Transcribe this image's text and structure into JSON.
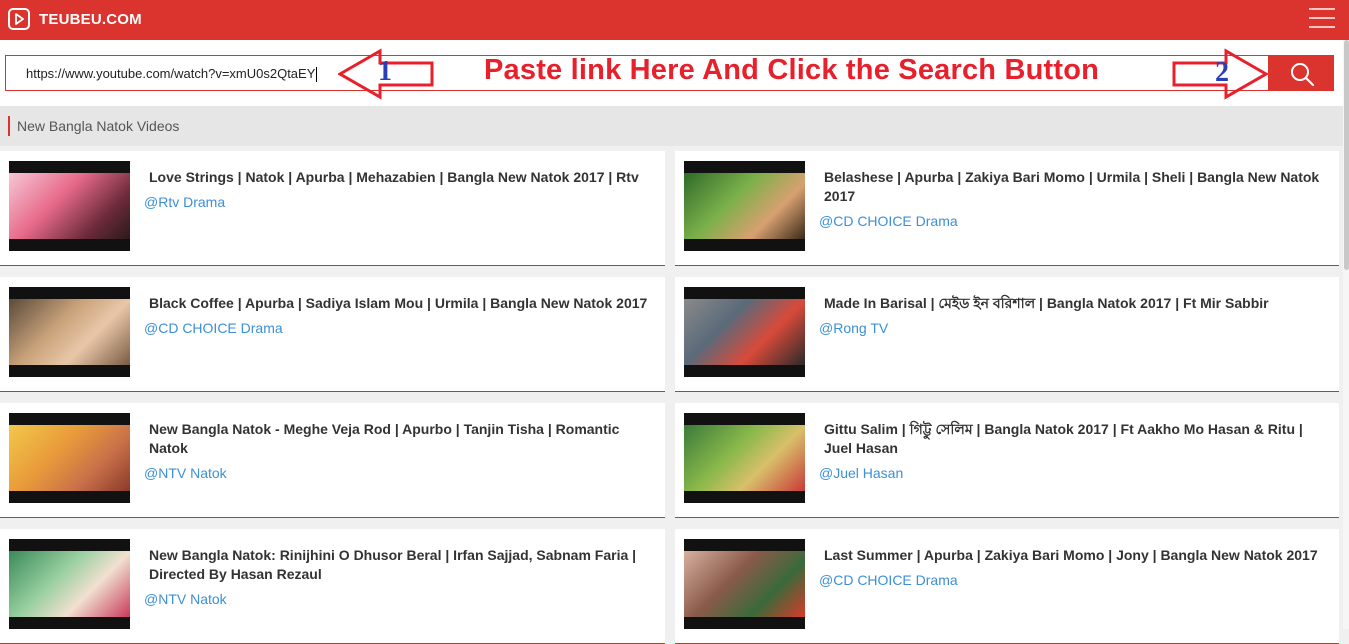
{
  "header": {
    "logo_text": "TEUBEU.COM",
    "accent_color": "#db332d"
  },
  "search": {
    "value": "https://www.youtube.com/watch?v=xmU0s2QtaEY",
    "button_icon": "search-icon"
  },
  "annotation": {
    "instruction": "Paste link Here And Click the Search Button",
    "step1": "1",
    "step2": "2",
    "instruction_color": "#e8202c",
    "number_color": "#2b3fb5"
  },
  "section": {
    "title": "New Bangla Natok Videos"
  },
  "videos": [
    {
      "title": "Love Strings | Natok | Apurba | Mehazabien | Bangla New Natok 2017 | Rtv",
      "channel": "@Rtv Drama"
    },
    {
      "title": "Belashese | Apurba | Zakiya Bari Momo | Urmila | Sheli | Bangla New Natok 2017",
      "channel": "@CD CHOICE Drama"
    },
    {
      "title": "Black Coffee | Apurba | Sadiya Islam Mou | Urmila | Bangla New Natok 2017",
      "channel": "@CD CHOICE Drama"
    },
    {
      "title": "Made In Barisal | মেইড ইন বরিশাল | Bangla Natok 2017 | Ft Mir Sabbir",
      "channel": "@Rong TV"
    },
    {
      "title": "New Bangla Natok - Meghe Veja Rod | Apurbo | Tanjin Tisha | Romantic Natok",
      "channel": "@NTV Natok"
    },
    {
      "title": "Gittu Salim | গিট্টু সেলিম | Bangla Natok 2017 | Ft Aakho Mo Hasan & Ritu | Juel Hasan",
      "channel": "@Juel Hasan"
    },
    {
      "title": "New Bangla Natok: Rinijhini O Dhusor Beral | Irfan Sajjad, Sabnam Faria | Directed By Hasan Rezaul",
      "channel": "@NTV Natok"
    },
    {
      "title": "Last Summer | Apurba | Zakiya Bari Momo | Jony | Bangla New Natok 2017",
      "channel": "@CD CHOICE Drama"
    }
  ]
}
